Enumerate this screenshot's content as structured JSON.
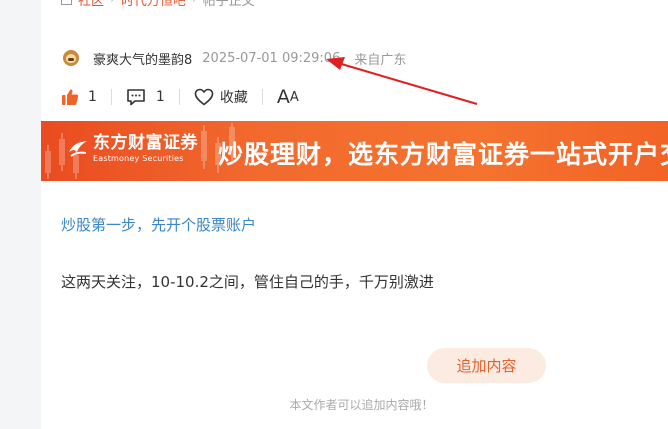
{
  "breadcrumb": {
    "items": [
      "社区",
      "时代万恒吧",
      "帖子正文"
    ]
  },
  "author": {
    "name": "豪爽大气的墨韵8",
    "time": "2025-07-01 09:29:06",
    "location": "来自广东",
    "avatar_icon": "bull-avatar-icon"
  },
  "actions": {
    "like_count": "1",
    "comment_count": "1",
    "favorite_label": "收藏",
    "font_toggle_large": "A",
    "font_toggle_small": "A"
  },
  "banner": {
    "logo_cn": "东方财富证券",
    "logo_en": "Eastmoney Securities",
    "slogan": "炒股理财，选东方财富证券一站式开户交"
  },
  "content": {
    "promo_link": "炒股第一步，先开个股票账户",
    "body": "这两天关注，10-10.2之间，管住自己的手，千万别激进"
  },
  "append": {
    "button_label": "追加内容",
    "hint": "本文作者可以追加内容哦！"
  },
  "colors": {
    "accent": "#e5612f",
    "banner": "#f26a2e",
    "link": "#3a86c8",
    "like": "#f0642c",
    "annotation_arrow": "#e02020"
  }
}
